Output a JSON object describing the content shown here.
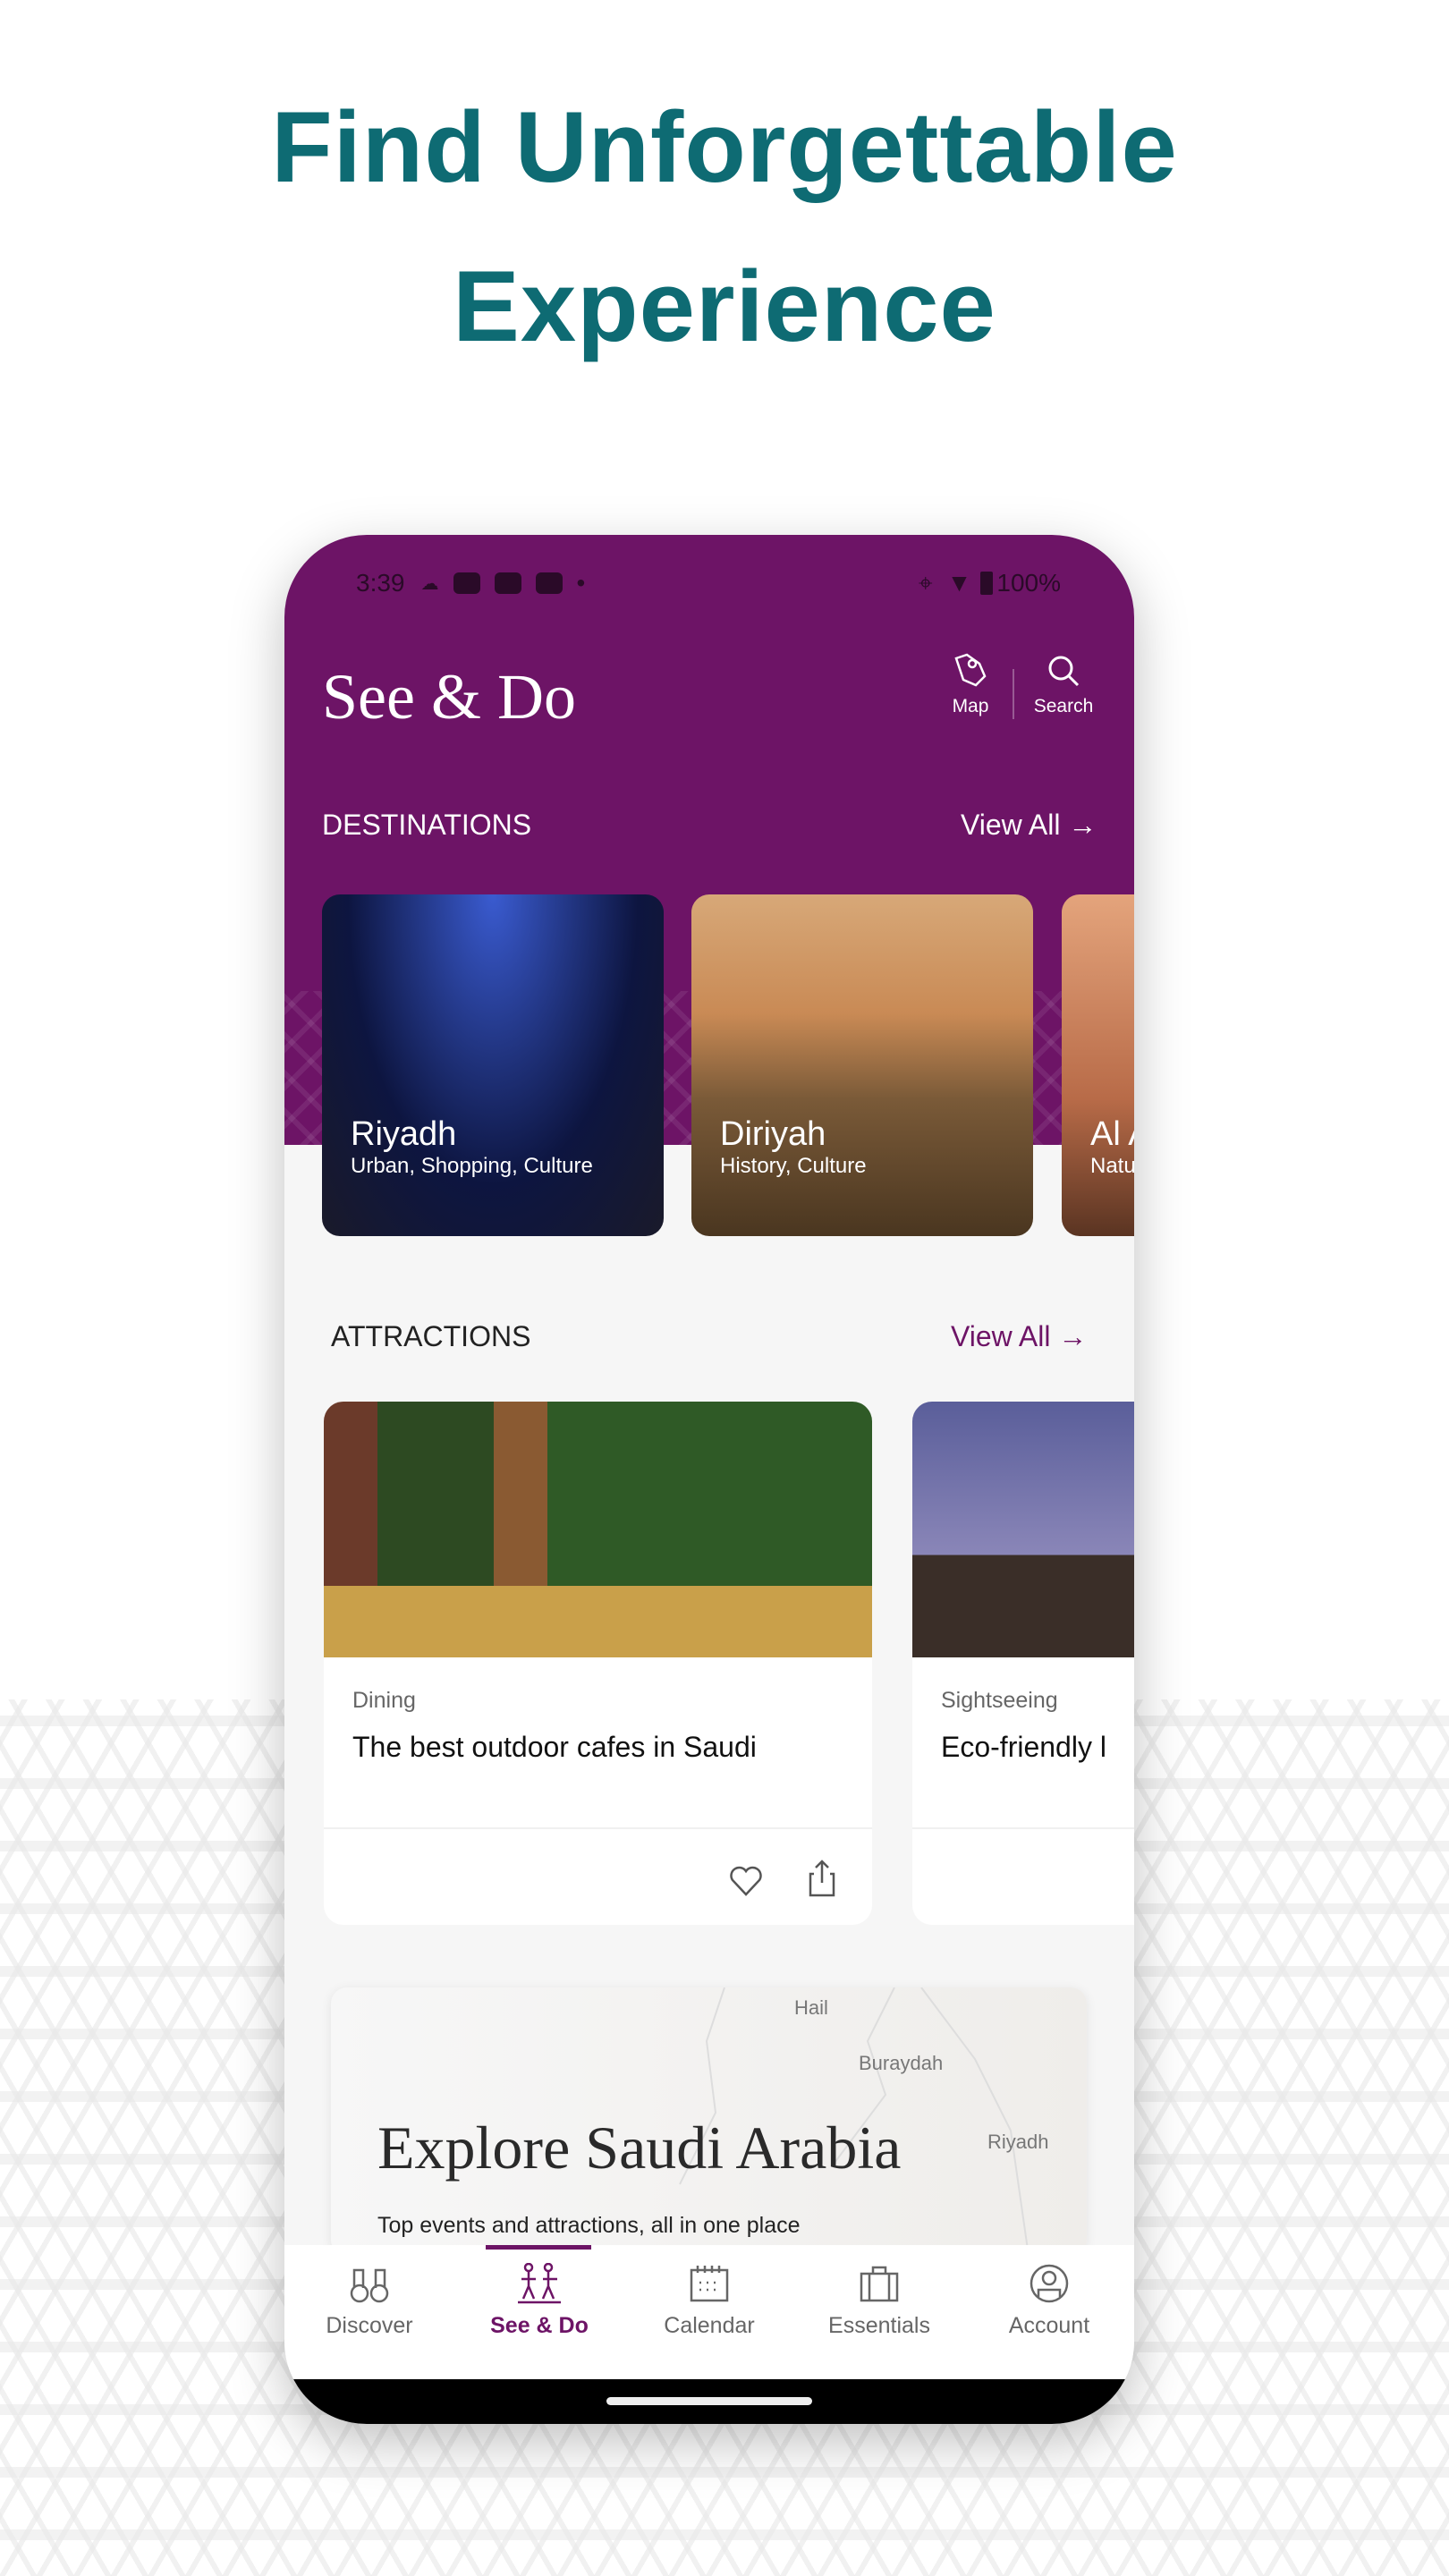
{
  "headline": {
    "line1": "Find Unforgettable",
    "line2": "Experience"
  },
  "status_bar": {
    "time": "3:39",
    "battery": "100%"
  },
  "header": {
    "title": "See & Do",
    "map_label": "Map",
    "search_label": "Search"
  },
  "destinations": {
    "heading": "DESTINATIONS",
    "view_all": "View All",
    "items": [
      {
        "name": "Riyadh",
        "tags": "Urban, Shopping, Culture"
      },
      {
        "name": "Diriyah",
        "tags": "History, Culture"
      },
      {
        "name": "Al A",
        "tags": "Natu"
      }
    ]
  },
  "attractions": {
    "heading": "ATTRACTIONS",
    "view_all": "View All",
    "items": [
      {
        "category": "Dining",
        "title": "The best outdoor cafes in Saudi"
      },
      {
        "category": "Sightseeing",
        "title": "Eco-friendly l"
      }
    ]
  },
  "map_card": {
    "title": "Explore Saudi Arabia",
    "subtitle": "Top events and attractions, all in one place",
    "cities": [
      "Hail",
      "Buraydah",
      "Riyadh"
    ]
  },
  "bottom_nav": {
    "active": "See & Do",
    "items": [
      {
        "label": "Discover",
        "icon": "binoculars-icon"
      },
      {
        "label": "See & Do",
        "icon": "people-walking-icon"
      },
      {
        "label": "Calendar",
        "icon": "calendar-icon"
      },
      {
        "label": "Essentials",
        "icon": "briefcase-icon"
      },
      {
        "label": "Account",
        "icon": "user-circle-icon"
      }
    ]
  },
  "colors": {
    "brand_purple": "#6d1466",
    "headline_teal": "#0e6b73"
  }
}
